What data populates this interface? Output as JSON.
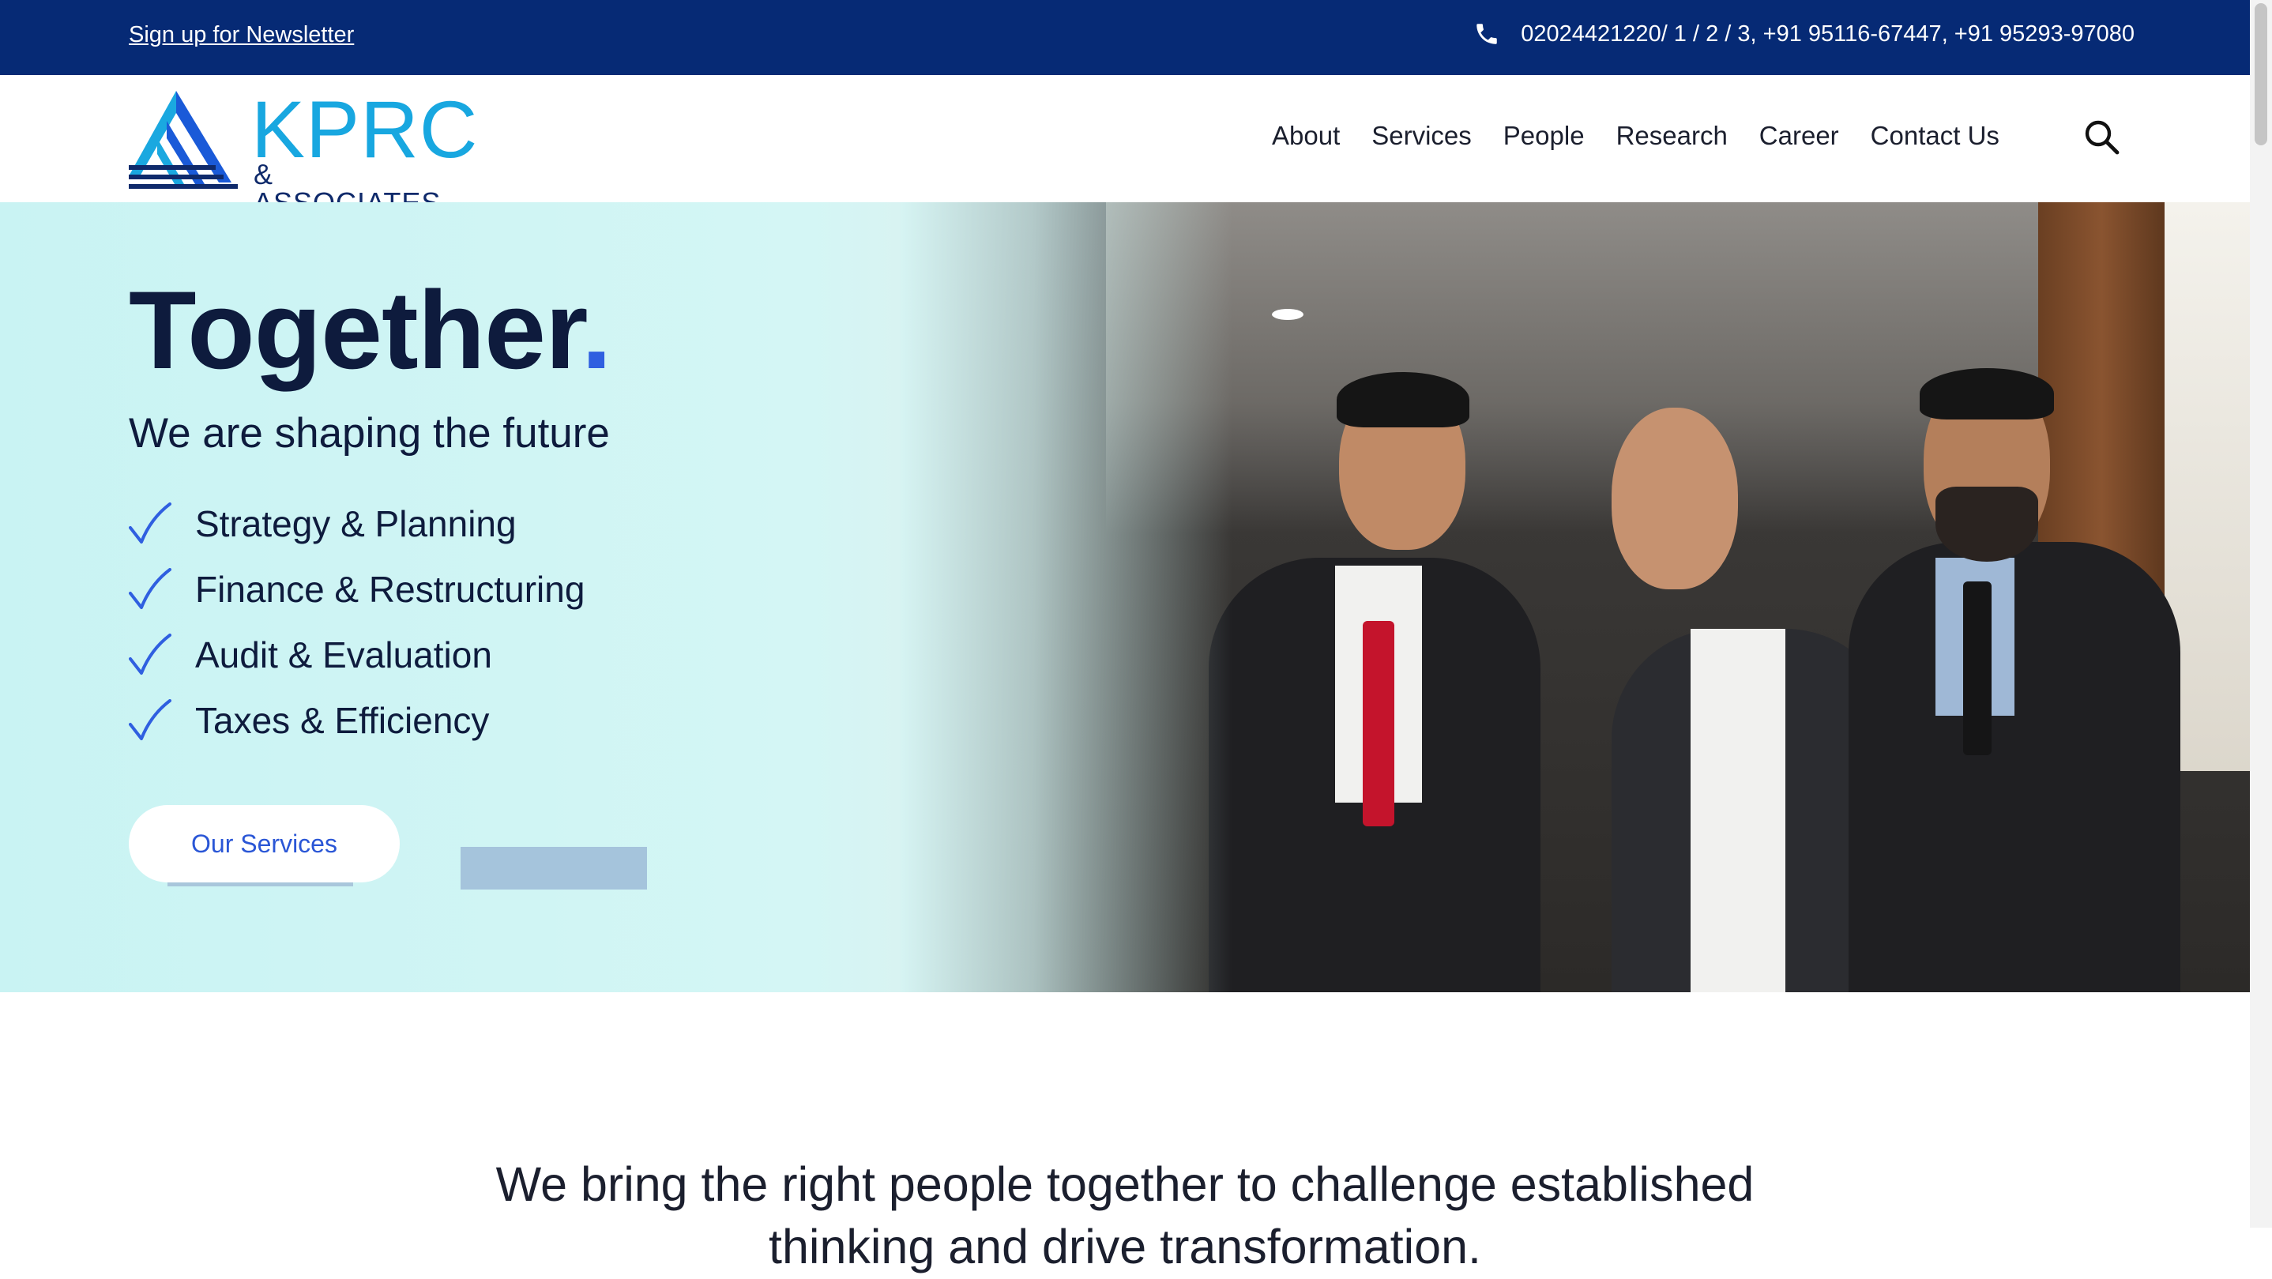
{
  "topbar": {
    "newsletter_label": "Sign up for Newsletter",
    "phone_text": "02024421220/ 1 / 2 / 3, +91 95116-67447, +91 95293-97080",
    "phone_icon": "phone-icon",
    "background": "#062a75"
  },
  "header": {
    "logo": {
      "main": "KPRC",
      "sub": "& ASSOCIATES"
    },
    "nav": [
      {
        "label": "About"
      },
      {
        "label": "Services"
      },
      {
        "label": "People"
      },
      {
        "label": "Research"
      },
      {
        "label": "Career"
      },
      {
        "label": "Contact Us"
      }
    ],
    "search_icon": "search-icon"
  },
  "hero": {
    "title": "Together",
    "title_dot": ".",
    "subtitle": "We are shaping the future",
    "features": [
      {
        "label": "Strategy & Planning",
        "icon": "check-icon"
      },
      {
        "label": "Finance & Restructuring",
        "icon": "check-icon"
      },
      {
        "label": "Audit & Evaluation",
        "icon": "check-icon"
      },
      {
        "label": "Taxes & Efficiency",
        "icon": "check-icon"
      }
    ],
    "cta_label": "Our Services",
    "accent": "#2f5fe0"
  },
  "intro": {
    "line1": "We bring the right people together to challenge established",
    "line2": "thinking and drive transformation."
  }
}
